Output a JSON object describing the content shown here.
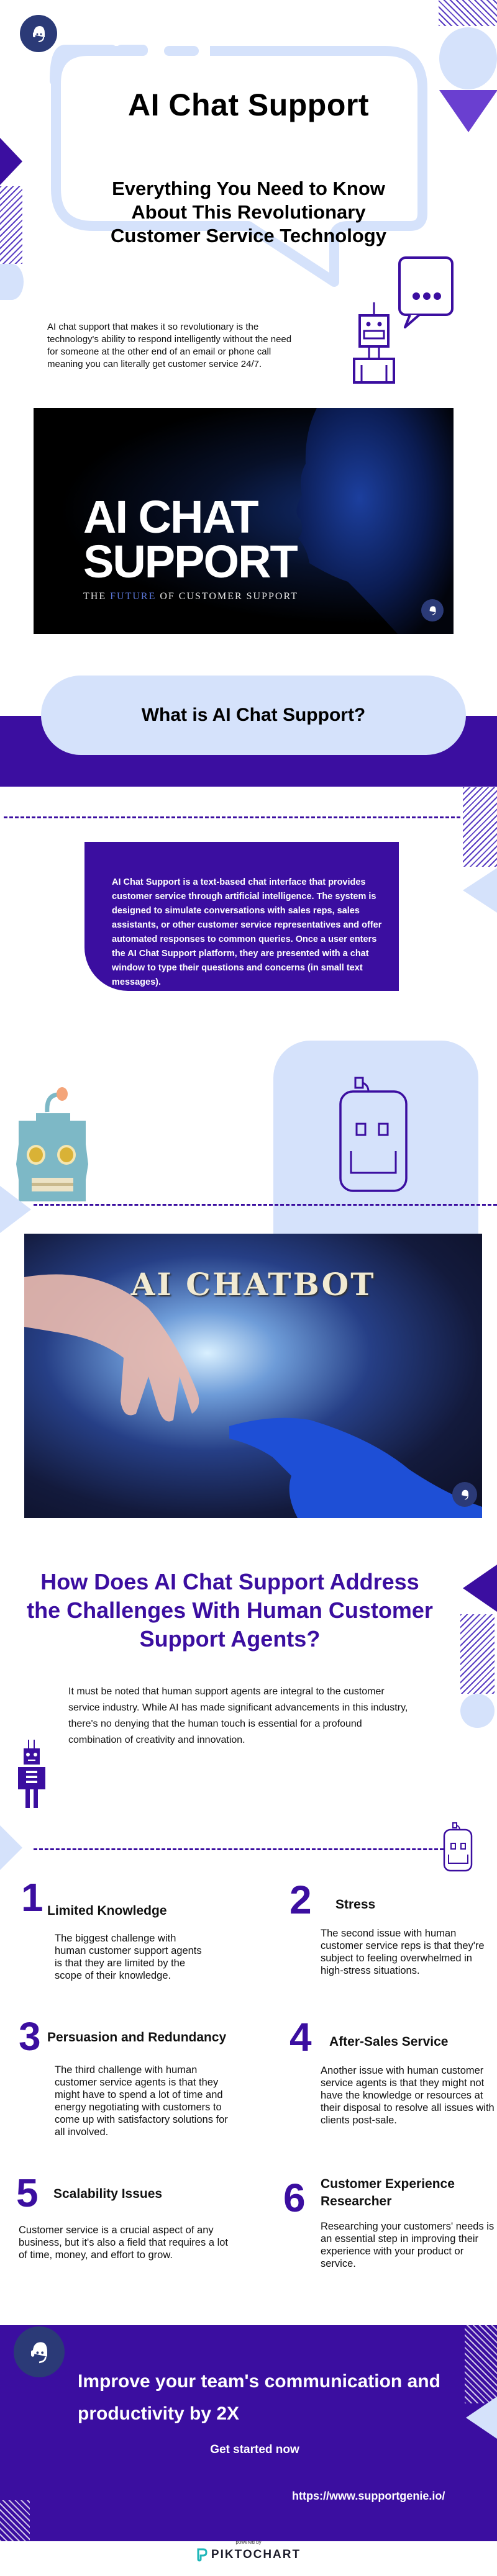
{
  "hero": {
    "title": "AI Chat Support",
    "subtitle": "Everything You Need to Know About This Revolutionary Customer Service Technology",
    "intro": " AI chat support that makes it so revolutionary is the technology's ability to respond intelligently without the need for someone at the other end of an email or phone call meaning you can literally get customer service 24/7."
  },
  "banner_image": {
    "line1": "AI CHAT",
    "line2": "SUPPORT",
    "tagline_pre": "THE ",
    "tagline_accent": "FUTURE",
    "tagline_post": " OF CUSTOMER SUPPORT"
  },
  "what_is": {
    "heading": "What is AI Chat Support?",
    "body": "AI Chat Support is a text-based chat interface that provides customer service through artificial intelligence. The system is designed to simulate conversations with sales reps, sales assistants, or other customer service representatives and offer automated responses to common queries. Once a user enters the AI Chat Support platform, they are presented with a chat window to type their questions and concerns (in small text messages)."
  },
  "chatbot_image": {
    "title": "AI CHATBOT"
  },
  "challenges": {
    "heading": "How Does AI Chat Support Address the Challenges With Human Customer Support Agents?",
    "intro": "It must be noted that human support agents are integral to the customer service industry. While AI has made significant advancements in this industry, there's no denying that the human touch is essential for a profound combination of creativity and innovation.",
    "items": [
      {
        "number": "1",
        "title": "Limited Knowledge",
        "body": "The biggest challenge with human customer support agents is that they are limited by the scope of their knowledge."
      },
      {
        "number": "2",
        "title": "Stress",
        "body": "The second issue with human customer service reps is that they're subject to feeling overwhelmed in high-stress situations."
      },
      {
        "number": "3",
        "title": "Persuasion and Redundancy",
        "body": "The third challenge with human customer service agents is that they might have to spend a lot of time and energy negotiating with customers to come up with satisfactory solutions for all involved."
      },
      {
        "number": "4",
        "title": "After-Sales Service",
        "body": "Another issue with human customer service agents is that they might not have the knowledge or resources at their disposal to resolve all issues with clients post-sale."
      },
      {
        "number": "5",
        "title": "Scalability Issues",
        "body": "Customer service is a crucial aspect of any business, but it's also a field that requires a lot of time, money, and effort to grow."
      },
      {
        "number": "6",
        "title": "Customer Experience Researcher",
        "body": "Researching your customers' needs is an essential step in improving their experience with your product or service."
      }
    ]
  },
  "cta": {
    "headline": "Improve your team's communication and productivity by 2X",
    "button": "Get started now",
    "url": "https://www.supportgenie.io/"
  },
  "footer": {
    "powered_by": "powered by",
    "brand": "PIKTOCHART"
  },
  "colors": {
    "primary_purple": "#3b0ea0",
    "light_blue": "#d5e2fb",
    "accent_violet": "#6a3fd0",
    "agent_navy": "#2b3a77"
  }
}
